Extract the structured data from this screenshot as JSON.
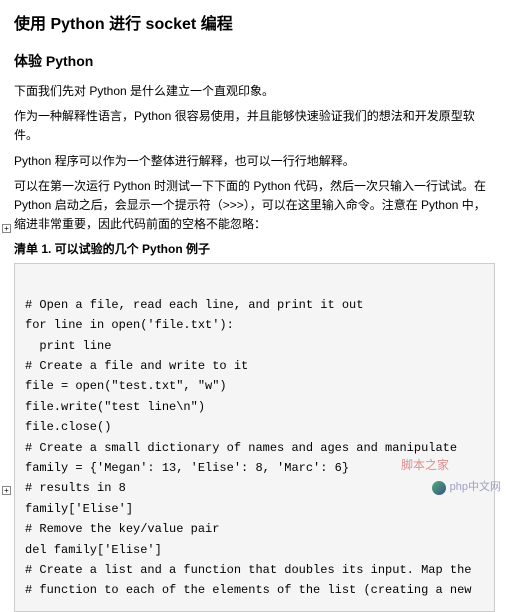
{
  "title": "使用 Python 进行 socket 编程",
  "section": "体验 Python",
  "paragraphs": {
    "p1": "下面我们先对 Python 是什么建立一个直观印象。",
    "p2": "作为一种解释性语言，Python 很容易使用，并且能够快速验证我们的想法和开发原型软件。",
    "p3": "Python 程序可以作为一个整体进行解释，也可以一行行地解释。",
    "p4": "可以在第一次运行 Python 时测试一下下面的 Python 代码，然后一次只输入一行试试。在 Python 启动之后，会显示一个提示符（>>>），可以在这里输入命令。注意在 Python 中，缩进非常重要，因此代码前面的空格不能忽略：",
    "listing_title": "清单 1. 可以试验的几个 Python 例子",
    "code": "\n# Open a file, read each line, and print it out\nfor line in open('file.txt'):\n  print line\n# Create a file and write to it\nfile = open(\"test.txt\", \"w\")\nfile.write(\"test line\\n\")\nfile.close()\n# Create a small dictionary of names and ages and manipulate\nfamily = {'Megan': 13, 'Elise': 8, 'Marc': 6}\n# results in 8\nfamily['Elise']\n# Remove the key/value pair\ndel family['Elise']\n# Create a list and a function that doubles its input. Map the\n# function to each of the elements of the list (creating a new"
  },
  "expand": "+",
  "watermarks": {
    "w1": "脚本之家",
    "w2": "php中文网"
  }
}
